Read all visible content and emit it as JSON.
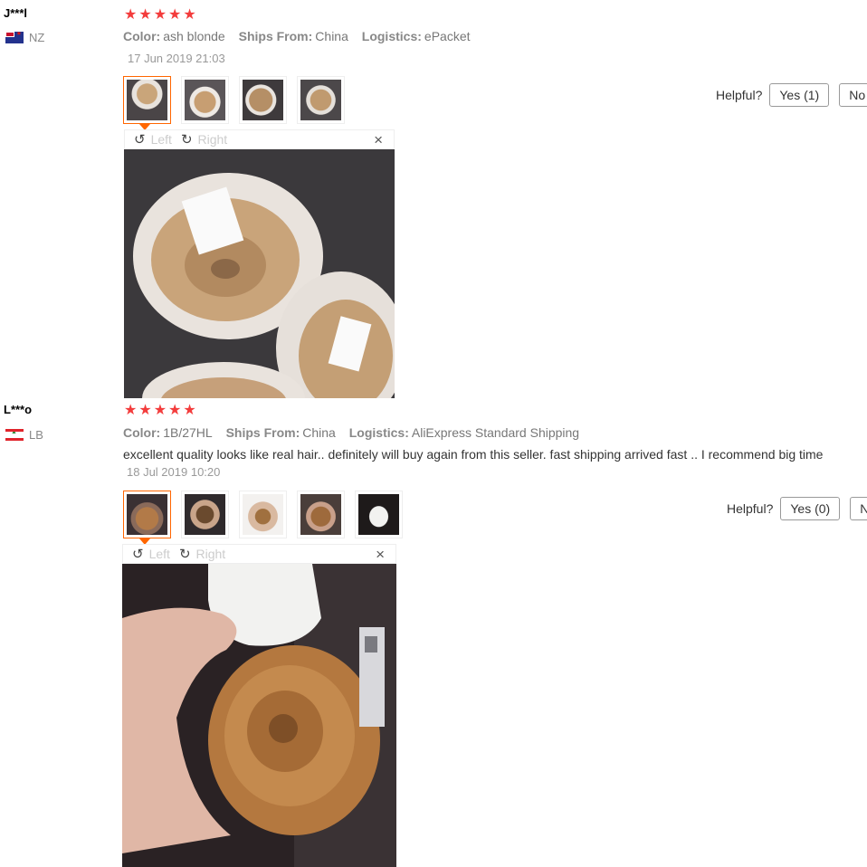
{
  "reviews": [
    {
      "user": "J***l",
      "country": "NZ",
      "stars": [
        "★",
        "★",
        "★",
        "★",
        "★"
      ],
      "color_label": "Color:",
      "color_value": "ash blonde",
      "ships_label": "Ships From:",
      "ships_value": "China",
      "logistics_label": "Logistics:",
      "logistics_value": "ePacket",
      "date": "17 Jun 2019 21:03",
      "helpful_label": "Helpful?",
      "yes_label": "Yes (1)",
      "no_label": "No",
      "viewer": {
        "left_label": "Left",
        "right_label": "Right",
        "close": "×"
      }
    },
    {
      "user": "L***o",
      "country": "LB",
      "stars": [
        "★",
        "★",
        "★",
        "★",
        "★"
      ],
      "color_label": "Color:",
      "color_value": "1B/27HL",
      "ships_label": "Ships From:",
      "ships_value": "China",
      "logistics_label": "Logistics:",
      "logistics_value": "AliExpress Standard Shipping",
      "feedback": "excellent quality looks like real hair.. definitely will buy again from this seller. fast shipping arrived fast .. I recommend big time",
      "date": "18 Jul 2019 10:20",
      "helpful_label": "Helpful?",
      "yes_label": "Yes (0)",
      "no_label": "No",
      "viewer": {
        "left_label": "Left",
        "right_label": "Right",
        "close": "×"
      }
    }
  ],
  "icons": {
    "rotate_left": "rotate-left-icon",
    "rotate_right": "rotate-right-icon",
    "close": "close-icon",
    "star": "star-icon"
  },
  "colors": {
    "star": "#f33c3c",
    "active_thumb": "#ff6600"
  }
}
